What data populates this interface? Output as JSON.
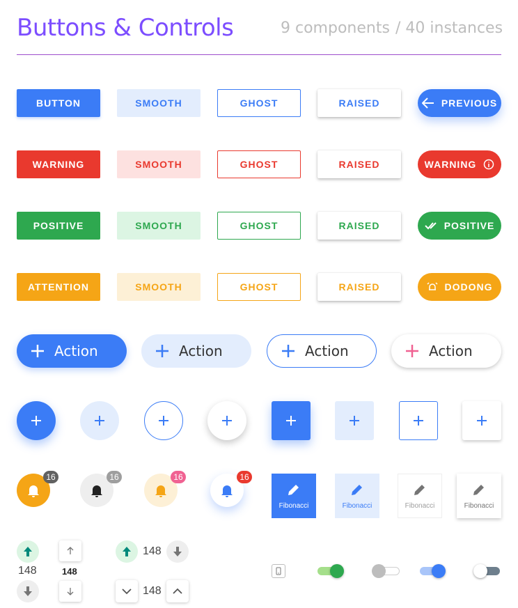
{
  "header": {
    "title": "Buttons & Controls",
    "components": "9 components",
    "instances": "/ 40 instances"
  },
  "colors": {
    "blue": "#3b7cf6",
    "red": "#e9392e",
    "green": "#2ea84f",
    "orange": "#f5a516",
    "pink": "#f06292",
    "purple": "#7c4dff"
  },
  "rows": {
    "blue": {
      "solid": "BUTTON",
      "smooth": "SMOOTH",
      "ghost": "GHOST",
      "raised": "RAISED",
      "pill": "PREVIOUS",
      "pill_icon": "arrow-left-icon"
    },
    "red": {
      "solid": "WARNING",
      "smooth": "SMOOTH",
      "ghost": "GHOST",
      "raised": "RAISED",
      "pill": "WARNING",
      "pill_icon": "info-icon"
    },
    "green": {
      "solid": "POSITIVE",
      "smooth": "SMOOTH",
      "ghost": "GHOST",
      "raised": "RAISED",
      "pill": "POSITIVE",
      "pill_icon": "check-icon"
    },
    "orange": {
      "solid": "ATTENTION",
      "smooth": "SMOOTH",
      "ghost": "GHOST",
      "raised": "RAISED",
      "pill": "DODONG",
      "pill_icon": "alarm-icon"
    }
  },
  "actions": {
    "label": "Action",
    "icon": "plus-icon"
  },
  "badges": {
    "count": "16",
    "icon": "bell-icon"
  },
  "tiles": {
    "label": "Fibonacci",
    "icon": "pencil-icon"
  },
  "steppers": {
    "value": "148",
    "up_icon": "arrow-up-icon",
    "down_icon": "arrow-down-icon"
  },
  "toggles": {
    "states": [
      "on",
      "off",
      "on",
      "off"
    ]
  }
}
